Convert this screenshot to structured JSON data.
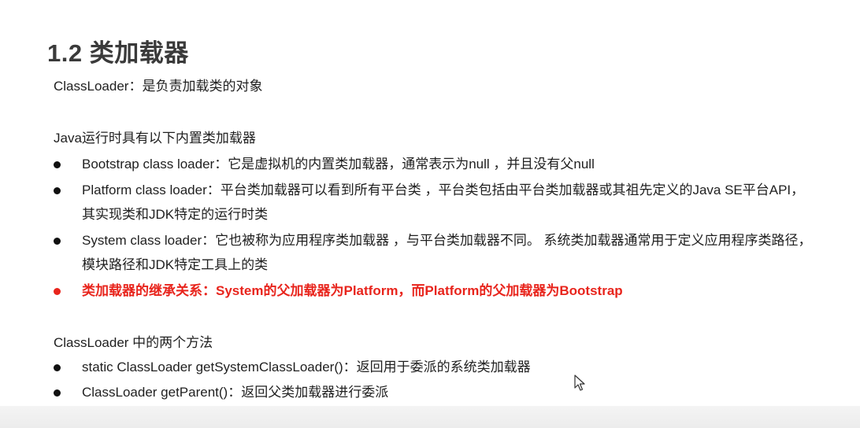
{
  "heading": "1.2 类加载器",
  "intro": "ClassLoader：是负责加载类的对象",
  "builtin_title": "Java运行时具有以下内置类加载器",
  "builtin_items": [
    {
      "lines": [
        "Bootstrap class loader：它是虚拟机的内置类加载器，通常表示为null ，并且没有父null"
      ]
    },
    {
      "lines": [
        "Platform class loader：平台类加载器可以看到所有平台类 ，平台类包括由平台类加载器或其祖先定义的Java SE平台API，",
        "其实现类和JDK特定的运行时类"
      ]
    },
    {
      "lines": [
        "System class loader：它也被称为应用程序类加载器 ，与平台类加载器不同。 系统类加载器通常用于定义应用程序类路径，",
        "模块路径和JDK特定工具上的类"
      ]
    },
    {
      "lines": [
        "类加载器的继承关系：System的父加载器为Platform，而Platform的父加载器为Bootstrap"
      ],
      "highlight": true
    }
  ],
  "methods_title": "ClassLoader 中的两个方法",
  "method_items": [
    "static ClassLoader getSystemClassLoader()：返回用于委派的系统类加载器",
    "ClassLoader getParent()：返回父类加载器进行委派"
  ],
  "colors": {
    "highlight": "#e8241c",
    "heading": "#3a3a3a",
    "text": "#1f1f1f"
  },
  "icons": {
    "cursor": "mouse-pointer-icon",
    "bullet": "filled-circle-bullet"
  }
}
